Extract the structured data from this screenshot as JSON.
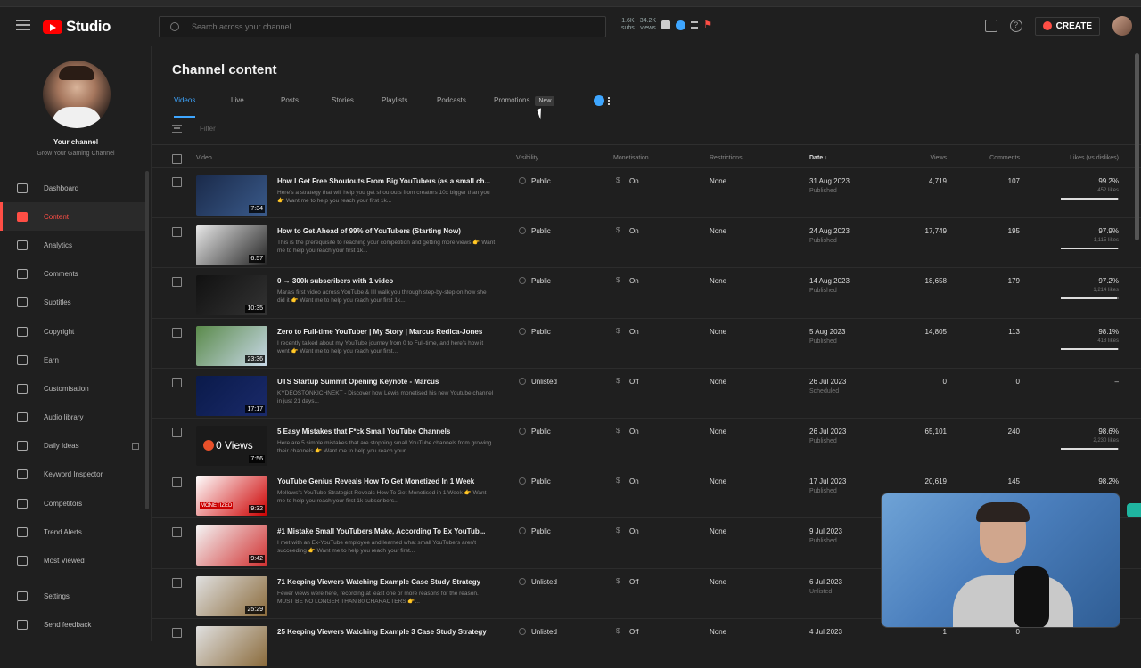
{
  "app": {
    "name": "Studio"
  },
  "search": {
    "placeholder": "Search across your channel"
  },
  "header_stats": {
    "a": "1.6K",
    "b": "34.2K",
    "a_sub": "subs",
    "b_sub": "views"
  },
  "header": {
    "create_label": "CREATE"
  },
  "channel": {
    "title": "Your channel",
    "name": "Grow Your Gaming Channel"
  },
  "sidebar": {
    "items": [
      {
        "label": "Dashboard",
        "icon": "dashboard-icon"
      },
      {
        "label": "Content",
        "icon": "content-icon",
        "active": true
      },
      {
        "label": "Analytics",
        "icon": "analytics-icon"
      },
      {
        "label": "Comments",
        "icon": "comments-icon"
      },
      {
        "label": "Subtitles",
        "icon": "subtitles-icon"
      },
      {
        "label": "Copyright",
        "icon": "copyright-icon"
      },
      {
        "label": "Earn",
        "icon": "earn-icon"
      },
      {
        "label": "Customisation",
        "icon": "customisation-icon"
      },
      {
        "label": "Audio library",
        "icon": "audio-library-icon"
      },
      {
        "label": "Daily Ideas",
        "icon": "daily-ideas-icon"
      },
      {
        "label": "Keyword Inspector",
        "icon": "keyword-inspector-icon"
      },
      {
        "label": "Competitors",
        "icon": "competitors-icon"
      },
      {
        "label": "Trend Alerts",
        "icon": "trend-alerts-icon"
      },
      {
        "label": "Most Viewed",
        "icon": "most-viewed-icon"
      },
      {
        "label": "Settings",
        "icon": "settings-icon"
      },
      {
        "label": "Send feedback",
        "icon": "feedback-icon"
      }
    ]
  },
  "main": {
    "title": "Channel content",
    "tabs": [
      "Videos",
      "Live",
      "Posts",
      "Stories",
      "Playlists",
      "Podcasts",
      "Promotions"
    ],
    "new_badge": "New",
    "filter_label": "Filter",
    "columns": {
      "video": "Video",
      "visibility": "Visibility",
      "monetisation": "Monetisation",
      "restrictions": "Restrictions",
      "date": "Date ↓",
      "views": "Views",
      "comments": "Comments",
      "likes": "Likes (vs dislikes)"
    }
  },
  "rows": [
    {
      "title": "How I Get Free Shoutouts From Big YouTubers (as a small ch...",
      "desc": "Here's a strategy that will help you get shoutouts from creators 10x bigger than you 👉 Want me to help you reach your first 1k...",
      "duration": "7:34",
      "visibility": "Public",
      "monetisation": "On",
      "restrictions": "None",
      "date": "31 Aug 2023",
      "status": "Published",
      "views": "4,719",
      "comments": "107",
      "likes": "99.2%",
      "likes_sub": "452 likes",
      "like_pct": 99.2,
      "thumb": [
        "#1a2a4a",
        "#3a5a8a"
      ]
    },
    {
      "title": "How to Get Ahead of 99% of YouTubers (Starting Now)",
      "desc": "This is the prerequisite to reaching your competition and getting more views 👉 Want me to help you reach your first 1k...",
      "duration": "6:57",
      "visibility": "Public",
      "monetisation": "On",
      "restrictions": "None",
      "date": "24 Aug 2023",
      "status": "Published",
      "views": "17,749",
      "comments": "195",
      "likes": "97.9%",
      "likes_sub": "1,115 likes",
      "like_pct": 97.9,
      "thumb": [
        "#e8e8e8",
        "#222222"
      ]
    },
    {
      "title": "0 → 300k subscribers with 1 video",
      "desc": "Mara's first video across YouTube & I'll walk you through step-by-step on how she did it 👉 Want me to help you reach your first 1k...",
      "duration": "10:35",
      "visibility": "Public",
      "monetisation": "On",
      "restrictions": "None",
      "date": "14 Aug 2023",
      "status": "Published",
      "views": "18,658",
      "comments": "179",
      "likes": "97.2%",
      "likes_sub": "1,214 likes",
      "like_pct": 97.2,
      "thumb": [
        "#111111",
        "#333333"
      ]
    },
    {
      "title": "Zero to Full-time YouTuber | My Story | Marcus Redica-Jones",
      "desc": "I recently talked about my YouTube journey from 0 to Full-time, and here's how it went 👉 Want me to help you reach your first...",
      "duration": "23:36",
      "visibility": "Public",
      "monetisation": "On",
      "restrictions": "None",
      "date": "5 Aug 2023",
      "status": "Published",
      "views": "14,805",
      "comments": "113",
      "likes": "98.1%",
      "likes_sub": "418 likes",
      "like_pct": 98.1,
      "thumb": [
        "#5a8a4a",
        "#c9d9e9"
      ]
    },
    {
      "title": "UTS Startup Summit Opening Keynote - Marcus",
      "desc": "KYDEOSTONKICHNEKT - Discover how Lewis monetised his new Youtube channel in just 21 days...",
      "duration": "17:17",
      "visibility": "Unlisted",
      "monetisation": "Off",
      "restrictions": "None",
      "date": "26 Jul 2023",
      "status": "Scheduled",
      "views": "0",
      "comments": "0",
      "likes": "–",
      "likes_sub": "",
      "like_pct": 0,
      "thumb": [
        "#0a1a4a",
        "#1a2a6a"
      ]
    },
    {
      "title": "5 Easy Mistakes that F*ck Small YouTube Channels",
      "desc": "Here are 5 simple mistakes that are stopping small YouTube channels from growing their channels 👉 Want me to help you reach your...",
      "duration": "7:56",
      "visibility": "Public",
      "monetisation": "On",
      "restrictions": "None",
      "date": "26 Jul 2023",
      "status": "Published",
      "views": "65,101",
      "comments": "240",
      "likes": "98.6%",
      "likes_sub": "2,230 likes",
      "like_pct": 98.6,
      "thumb_label": "0 Views",
      "thumb": [
        "#1a1a1a",
        "#1a1a1a"
      ]
    },
    {
      "title": "YouTube Genius Reveals How To Get Monetized In 1 Week",
      "desc": "Mellows's YouTube Strategist Reveals How To Get Monetised in 1 Week 👉 Want me to help you reach your first 1k subscribers...",
      "duration": "9:32",
      "visibility": "Public",
      "monetisation": "On",
      "restrictions": "None",
      "date": "17 Jul 2023",
      "status": "Published",
      "views": "20,619",
      "comments": "145",
      "likes": "98.2%",
      "likes_sub": "",
      "like_pct": 98.2,
      "thumb_label": "MONETIZED",
      "thumb": [
        "#ffffff",
        "#cc0000"
      ]
    },
    {
      "title": "#1 Mistake Small YouTubers Make, According To Ex YouTub...",
      "desc": "I met with an Ex-YouTube employee and learned what small YouTubers aren't succeeding 👉 Want me to help you reach your first...",
      "duration": "9:42",
      "visibility": "Public",
      "monetisation": "On",
      "restrictions": "None",
      "date": "9 Jul 2023",
      "status": "Published",
      "views": "",
      "comments": "",
      "likes": "",
      "likes_sub": "",
      "like_pct": 0,
      "thumb": [
        "#f4f4f4",
        "#d03030"
      ]
    },
    {
      "title": "71 Keeping Viewers Watching Example Case Study Strategy",
      "desc": "Fewer views were here, recording at least one or more reasons for the reason. MUST BE NO LONGER THAN 80 CHARACTERS 👉...",
      "duration": "25:29",
      "visibility": "Unlisted",
      "monetisation": "Off",
      "restrictions": "None",
      "date": "6 Jul 2023",
      "status": "Unlisted",
      "views": "",
      "comments": "",
      "likes": "",
      "likes_sub": "",
      "like_pct": 0,
      "thumb": [
        "#e0e0e0",
        "#8a6a3a"
      ]
    },
    {
      "title": "25 Keeping Viewers Watching Example 3 Case Study Strategy",
      "desc": "",
      "duration": "",
      "visibility": "Unlisted",
      "monetisation": "Off",
      "restrictions": "None",
      "date": "4 Jul 2023",
      "status": "",
      "views": "1",
      "comments": "0",
      "likes": "",
      "likes_sub": "",
      "like_pct": 0,
      "thumb": [
        "#e0e0e0",
        "#8a6a3a"
      ]
    }
  ]
}
